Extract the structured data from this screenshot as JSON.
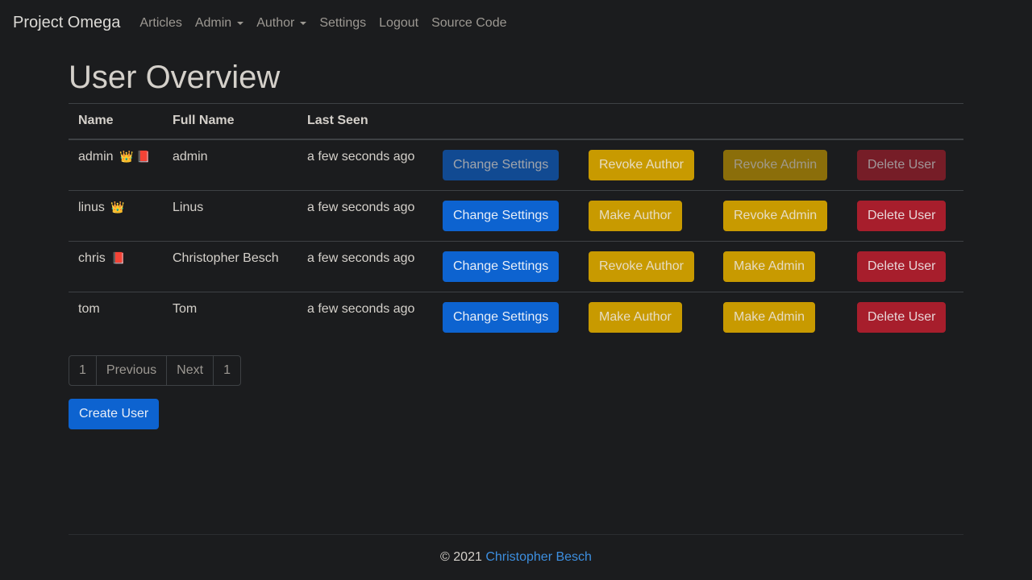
{
  "navbar": {
    "brand": "Project Omega",
    "items": [
      {
        "label": "Articles",
        "dropdown": false
      },
      {
        "label": "Admin",
        "dropdown": true
      },
      {
        "label": "Author",
        "dropdown": true
      },
      {
        "label": "Settings",
        "dropdown": false
      },
      {
        "label": "Logout",
        "dropdown": false
      },
      {
        "label": "Source Code",
        "dropdown": false
      }
    ]
  },
  "page_title": "User Overview",
  "table": {
    "headers": [
      "Name",
      "Full Name",
      "Last Seen"
    ],
    "rows": [
      {
        "name": "admin",
        "badges": "👑 📕",
        "full_name": "admin",
        "last_seen": "a few seconds ago",
        "actions": {
          "settings": "Change Settings",
          "author": "Revoke Author",
          "admin": "Revoke Admin",
          "delete": "Delete User"
        },
        "disabled": true
      },
      {
        "name": "linus",
        "badges": "👑",
        "full_name": "Linus",
        "last_seen": "a few seconds ago",
        "actions": {
          "settings": "Change Settings",
          "author": "Make Author",
          "admin": "Revoke Admin",
          "delete": "Delete User"
        },
        "disabled": false
      },
      {
        "name": "chris",
        "badges": "📕",
        "full_name": "Christopher Besch",
        "last_seen": "a few seconds ago",
        "actions": {
          "settings": "Change Settings",
          "author": "Revoke Author",
          "admin": "Make Admin",
          "delete": "Delete User"
        },
        "disabled": false
      },
      {
        "name": "tom",
        "badges": "",
        "full_name": "Tom",
        "last_seen": "a few seconds ago",
        "actions": {
          "settings": "Change Settings",
          "author": "Make Author",
          "admin": "Make Admin",
          "delete": "Delete User"
        },
        "disabled": false
      }
    ]
  },
  "pagination": {
    "first": "1",
    "previous": "Previous",
    "next": "Next",
    "last": "1"
  },
  "create_user_label": "Create User",
  "footer": {
    "copyright": "© 2021",
    "author_link": "Christopher Besch"
  },
  "colors": {
    "primary": "#0d63d0",
    "warning": "#c89a00",
    "danger": "#a71e2c",
    "link": "#3d8fe0",
    "background": "#1b1c1e"
  }
}
